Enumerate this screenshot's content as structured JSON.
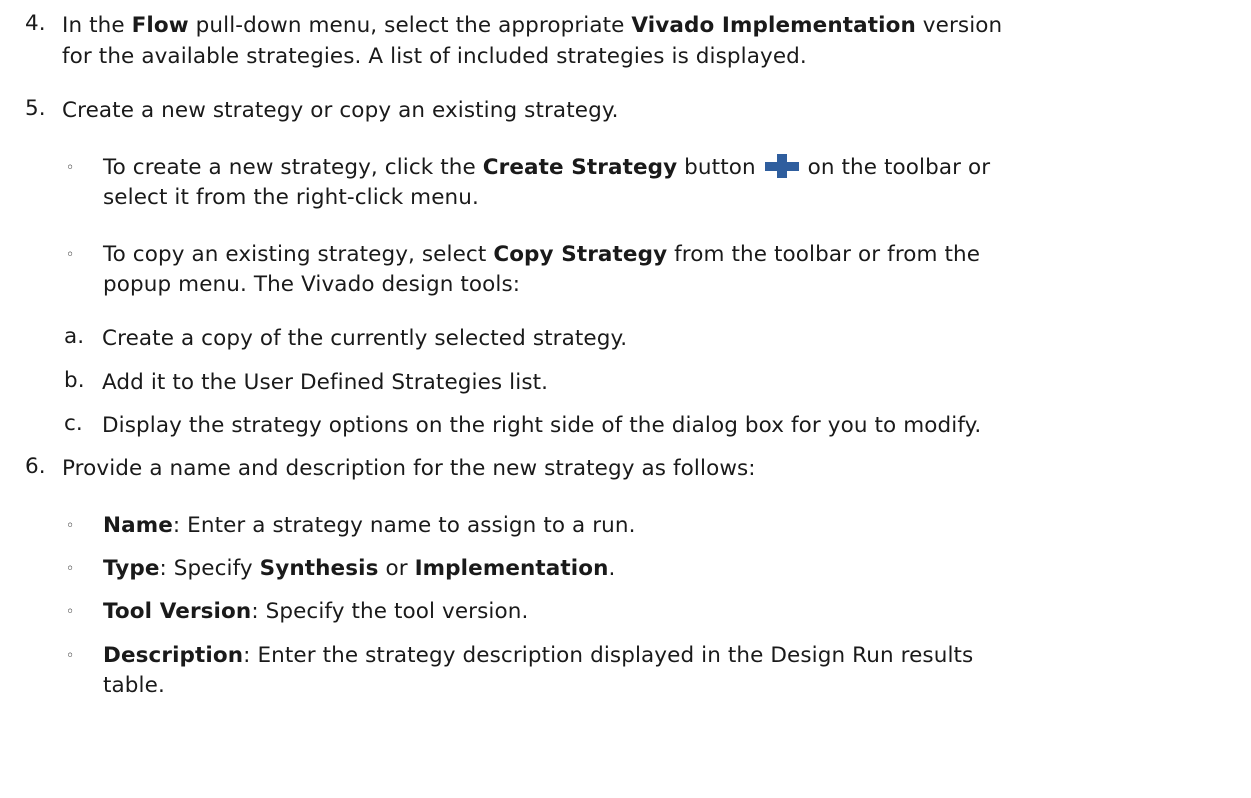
{
  "step4": {
    "num": "4.",
    "l1": {
      "a": "In the ",
      "b1": "Flow",
      "c": " pull-down menu, select the appropriate ",
      "b2": "Vivado Implementation",
      "d": " version"
    },
    "l2": "for the available strategies. A list of included strategies is displayed."
  },
  "step5": {
    "num": "5.",
    "text": "Create a new strategy or copy an existing strategy.",
    "bullet_create": {
      "l1": {
        "a": "To create a new strategy, click the ",
        "b": "Create Strategy",
        "c": " button",
        "icon": "plus-icon",
        "d": " on the toolbar or"
      },
      "l2": "select it from the right-click menu."
    },
    "bullet_copy": {
      "l1": {
        "a": "To copy an existing strategy, select ",
        "b": "Copy Strategy",
        "c": " from the toolbar or from the"
      },
      "l2": "popup menu. The Vivado design tools:"
    },
    "substeps": [
      {
        "label": "a.",
        "text": "Create a copy of the currently selected strategy."
      },
      {
        "label": "b.",
        "text": "Add it to the User Defined Strategies list."
      },
      {
        "label": "c.",
        "text": "Display the strategy options on the right side of the dialog box for you to modify."
      }
    ]
  },
  "step6": {
    "num": "6.",
    "text": "Provide a name and description for the new strategy as follows:",
    "name": {
      "term": "Name",
      "text": ": Enter a strategy name to assign to a run."
    },
    "type": {
      "term": "Type",
      "a": ": Specify ",
      "b1": "Synthesis",
      "c": " or ",
      "b2": "Implementation",
      "d": "."
    },
    "tool_version": {
      "term": "Tool Version",
      "text": ": Specify the tool version."
    },
    "description": {
      "term": "Description",
      "l1": ": Enter the strategy description displayed in the Design Run results",
      "l2": "table."
    }
  },
  "bullet_char": "◦"
}
